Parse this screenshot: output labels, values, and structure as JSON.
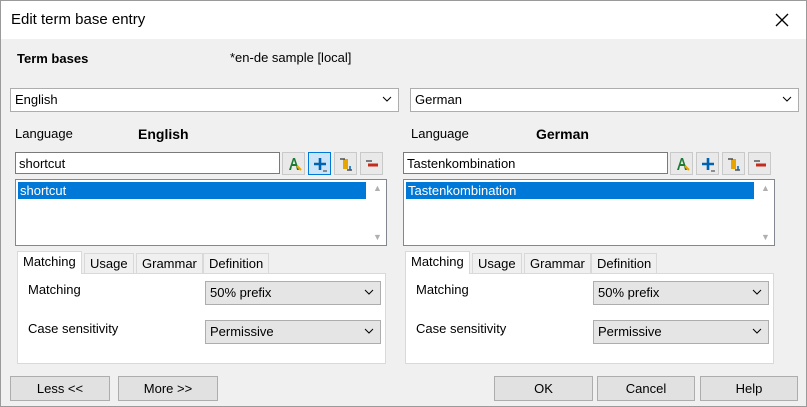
{
  "dialog": {
    "title": "Edit term base entry"
  },
  "termbases": {
    "label": "Term bases",
    "value": "*en-de sample [local]"
  },
  "left": {
    "language_select": "English",
    "language_label": "Language",
    "language_value": "English",
    "term_input": "shortcut",
    "terms": [
      "shortcut"
    ],
    "tabs": [
      "Matching",
      "Usage",
      "Grammar",
      "Definition"
    ],
    "matching_label": "Matching",
    "matching_value": "50% prefix",
    "case_label": "Case sensitivity",
    "case_value": "Permissive"
  },
  "right": {
    "language_select": "German",
    "language_label": "Language",
    "language_value": "German",
    "term_input": "Tastenkombination",
    "terms": [
      "Tastenkombination"
    ],
    "tabs": [
      "Matching",
      "Usage",
      "Grammar",
      "Definition"
    ],
    "matching_label": "Matching",
    "matching_value": "50% prefix",
    "case_label": "Case sensitivity",
    "case_value": "Permissive"
  },
  "buttons": {
    "less": "Less <<",
    "more": "More >>",
    "ok": "OK",
    "cancel": "Cancel",
    "help": "Help"
  },
  "colors": {
    "selection": "#0078d7",
    "add_icon": "#0063b1",
    "bold_icon": "#1e7b34",
    "delete_icon": "#c42b1c",
    "edit_icon": "#e8a400"
  }
}
